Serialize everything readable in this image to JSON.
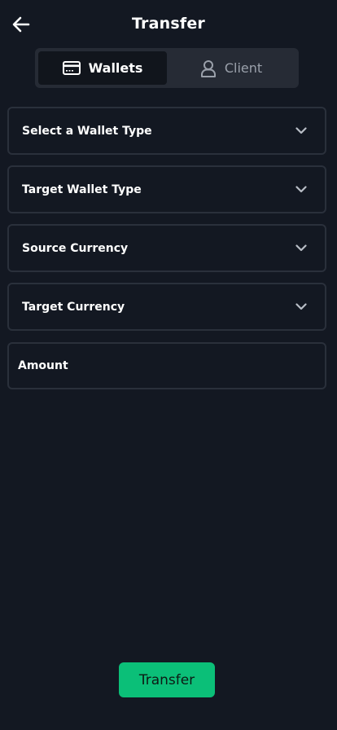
{
  "header": {
    "title": "Transfer",
    "back_icon": "arrow-left-icon"
  },
  "tabs": [
    {
      "label": "Wallets",
      "icon": "credit-card-icon",
      "active": true
    },
    {
      "label": "Client",
      "icon": "user-icon",
      "active": false
    }
  ],
  "form": {
    "wallet_type": {
      "label": "Select a Wallet Type"
    },
    "target_wallet_type": {
      "label": "Target Wallet Type"
    },
    "source_currency": {
      "label": "Source Currency"
    },
    "target_currency": {
      "label": "Target Currency"
    },
    "amount": {
      "placeholder": "Amount",
      "value": ""
    }
  },
  "submit": {
    "label": "Transfer"
  },
  "colors": {
    "background": "#131822",
    "tab_bar": "#262b35",
    "tab_active": "#11151c",
    "field_border": "#2a303b",
    "accent": "#0bbf78"
  }
}
